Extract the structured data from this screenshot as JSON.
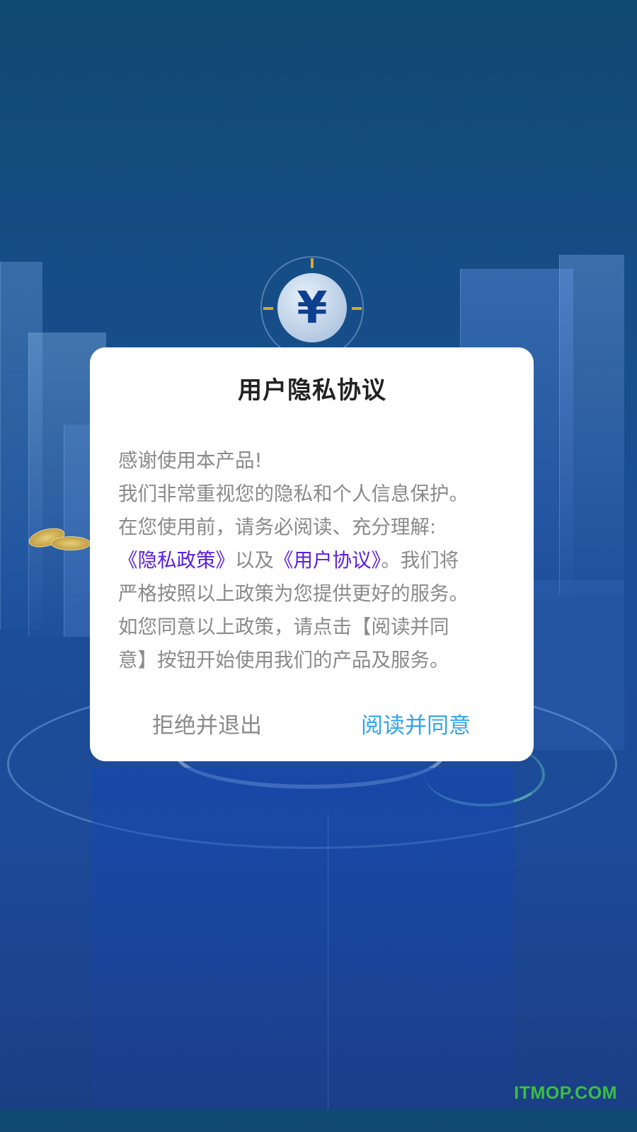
{
  "dialog": {
    "title": "用户隐私协议",
    "body": {
      "line1": "感谢使用本产品!",
      "line2": "我们非常重视您的隐私和个人信息保护。",
      "line3": "在您使用前，请务必阅读、充分理解:",
      "link_privacy": "《隐私政策》",
      "and_text": "以及",
      "link_terms": "《用户协议》",
      "line4_tail": "。我们将",
      "line5": "严格按照以上政策为您提供更好的服务。",
      "line6": "如您同意以上政策，请点击【阅读并同",
      "line7": "意】按钮开始使用我们的产品及服务。"
    },
    "reject_label": "拒绝并退出",
    "agree_label": "阅读并同意"
  },
  "background": {
    "badge_symbol": "¥",
    "badge_icon": "yen-icon"
  },
  "watermark": "ITMOP.COM",
  "colors": {
    "link": "#5a1ee0",
    "agree": "#2fa4f0",
    "body_text": "#8a8a8a",
    "title": "#222222",
    "watermark": "#3bbf43"
  }
}
